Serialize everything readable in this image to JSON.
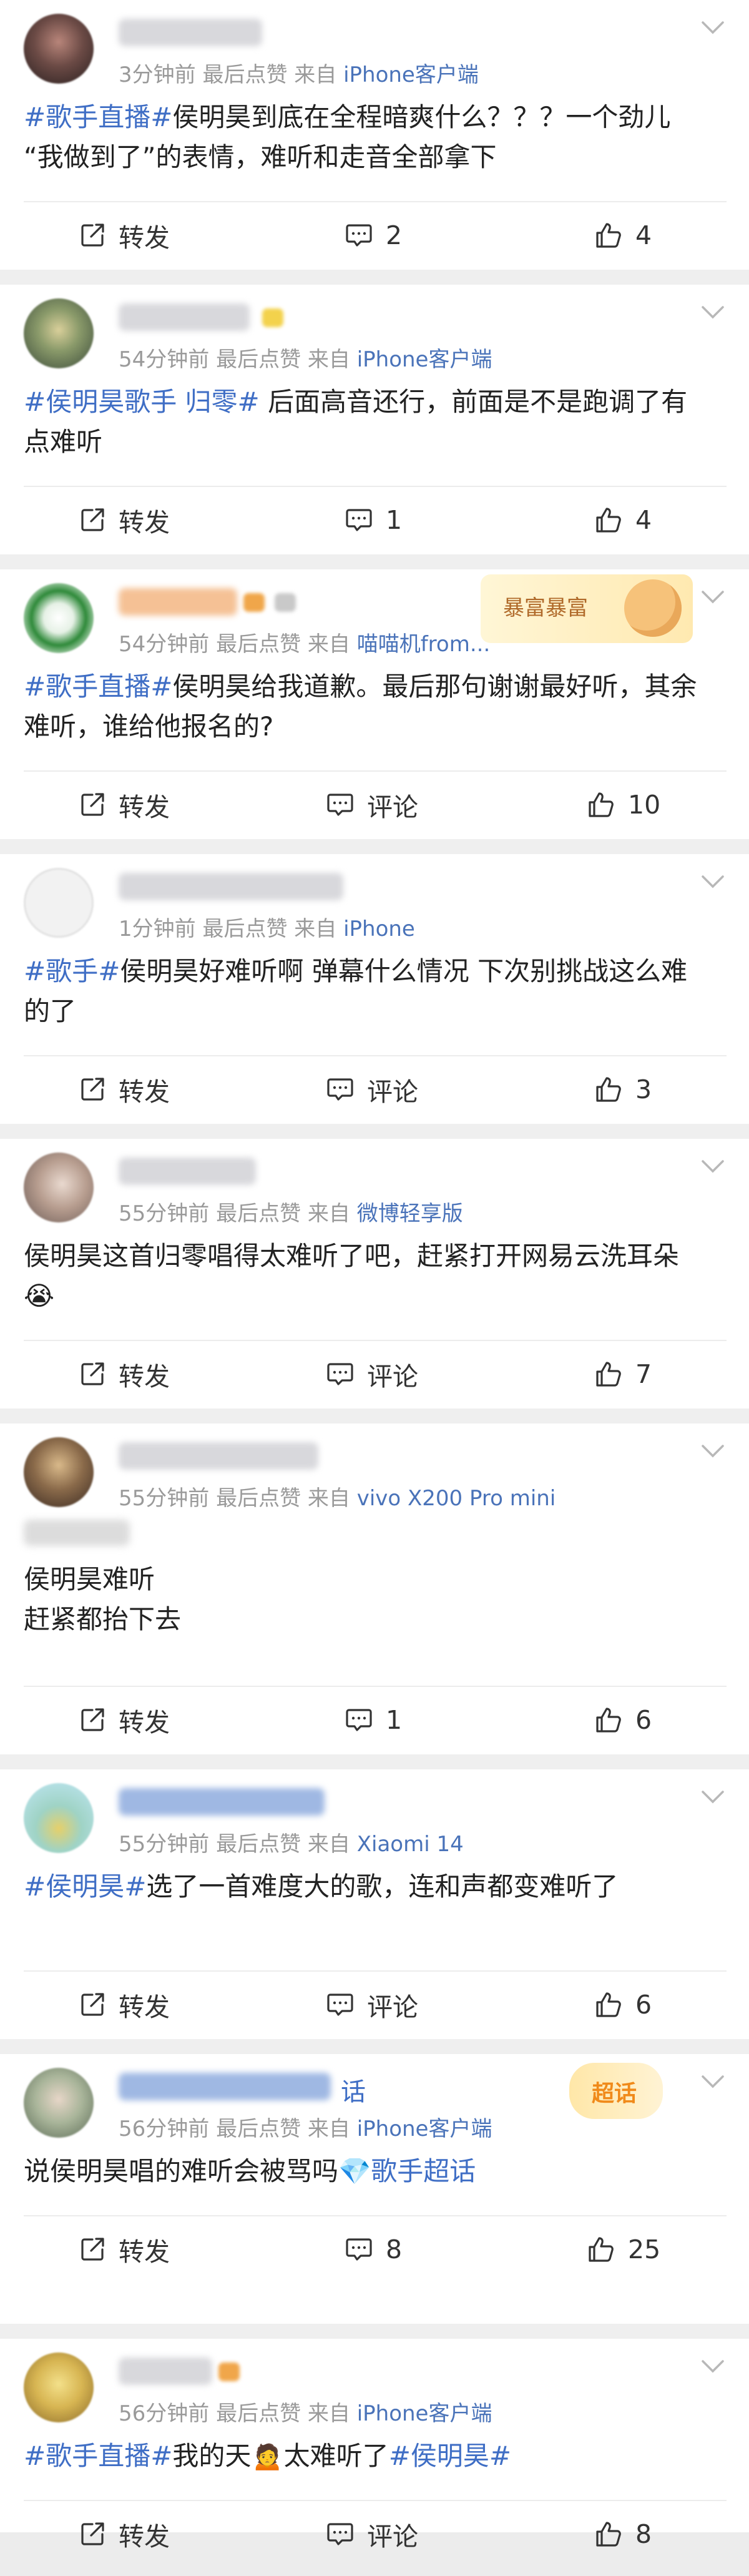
{
  "meta_parts": {
    "sep1": "前",
    "latest_like": "最后点赞",
    "from": "来自"
  },
  "actions": {
    "repost": "转发",
    "comment": "评论"
  },
  "posts": [
    {
      "time": "3分钟",
      "source": "iPhone客户端",
      "content": [
        {
          "type": "tag",
          "text": "#歌手直播#"
        },
        {
          "type": "text",
          "text": "侯明昊到底在全程暗爽什么？？？一个劲儿\n“我做到了”的表情，难听和走音全部拿下"
        }
      ],
      "comment_count": "2",
      "like_count": "4"
    },
    {
      "time": "54分钟",
      "source": "iPhone客户端",
      "content": [
        {
          "type": "tag",
          "text": "#侯明昊歌手 归零#"
        },
        {
          "type": "text",
          "text": " 后面高音还行，前面是不是跑调了有\n点难听"
        }
      ],
      "comment_count": "1",
      "like_count": "4"
    },
    {
      "time": "54分钟",
      "source": "喵喵机from...",
      "content": [
        {
          "type": "tag",
          "text": "#歌手直播#"
        },
        {
          "type": "text",
          "text": "侯明昊给我道歉。最后那句谢谢最好听，其余\n难听，谁给他报名的?"
        }
      ],
      "comment_count": "",
      "like_count": "10",
      "deco_text": "暴富暴富"
    },
    {
      "time": "1分钟",
      "source": "iPhone",
      "content": [
        {
          "type": "tag",
          "text": "#歌手#"
        },
        {
          "type": "text",
          "text": "侯明昊好难听啊 弹幕什么情况 下次别挑战这么难\n的了"
        }
      ],
      "comment_count": "",
      "like_count": "3"
    },
    {
      "time": "55分钟",
      "source": "微博轻享版",
      "content": [
        {
          "type": "text",
          "text": "侯明昊这首归零唱得太难听了吧，赶紧打开网易云洗耳朵\n😭"
        }
      ],
      "comment_count": "",
      "like_count": "7"
    },
    {
      "time": "55分钟",
      "source": "vivo X200 Pro mini",
      "content": [
        {
          "type": "text",
          "text": "侯明昊难听\n赶紧都抬下去"
        }
      ],
      "comment_count": "1",
      "like_count": "6"
    },
    {
      "time": "55分钟",
      "source": "Xiaomi 14",
      "content": [
        {
          "type": "tag",
          "text": "#侯明昊#"
        },
        {
          "type": "text",
          "text": "选了一首难度大的歌，连和声都变难听了"
        }
      ],
      "comment_count": "",
      "like_count": "6"
    },
    {
      "time": "56分钟",
      "source": "iPhone客户端",
      "content": [
        {
          "type": "text",
          "text": "说侯明昊唱的难听会被骂吗"
        },
        {
          "type": "tag",
          "text": "💎歌手超话"
        }
      ],
      "comment_count": "8",
      "like_count": "25",
      "name_suffix": "话",
      "deco_text": "超话"
    },
    {
      "time": "56分钟",
      "source": "iPhone客户端",
      "content": [
        {
          "type": "tag",
          "text": "#歌手直播#"
        },
        {
          "type": "text",
          "text": "我的天🙍太难听了"
        },
        {
          "type": "tag",
          "text": "#侯明昊#"
        }
      ],
      "comment_count": "",
      "like_count": "8"
    }
  ],
  "colors": {
    "tag_blue": "#3f6ec5",
    "meta_gray": "#9a9a9a",
    "divider": "#efefef"
  },
  "icons": [
    "chevron-down-icon",
    "repost-icon",
    "comment-icon",
    "like-icon"
  ]
}
